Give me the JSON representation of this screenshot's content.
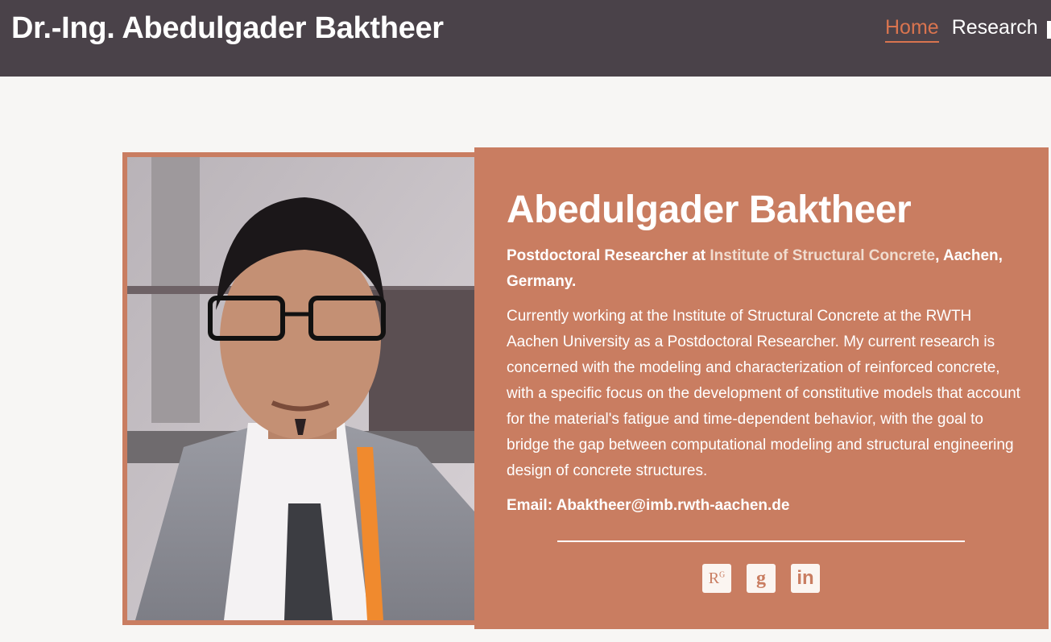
{
  "header": {
    "site_title": "Dr.-Ing. Abedulgader Baktheer",
    "nav": [
      {
        "label": "Home",
        "active": true
      },
      {
        "label": "Research",
        "active": false
      }
    ]
  },
  "profile": {
    "photo_alt": "Portrait photo",
    "name": "Abedulgader Baktheer",
    "role_prefix": "Postdoctoral Researcher at ",
    "institute": "Institute of Structural Concrete",
    "role_suffix": ", Aachen, Germany.",
    "bio": "Currently working at the Institute of Structural Concrete at the RWTH Aachen University as a Postdoctoral Researcher. My current research is concerned with the modeling and characterization of reinforced concrete, with a specific focus on the development of constitutive models that account for the material's fatigue and time-dependent behavior, with the goal to bridge the gap between computational modeling and structural engineering design of concrete structures.",
    "email": "Email: Abaktheer@imb.rwth-aachen.de",
    "socials": [
      {
        "icon": "researchgate-icon",
        "glyph": "R",
        "sup": "G"
      },
      {
        "icon": "google-scholar-icon",
        "glyph": "g"
      },
      {
        "icon": "linkedin-icon",
        "glyph": "in"
      }
    ]
  },
  "colors": {
    "header_bg": "#4a4249",
    "accent": "#d9744f",
    "card_bg": "#c97d61",
    "page_bg": "#f7f6f4"
  }
}
